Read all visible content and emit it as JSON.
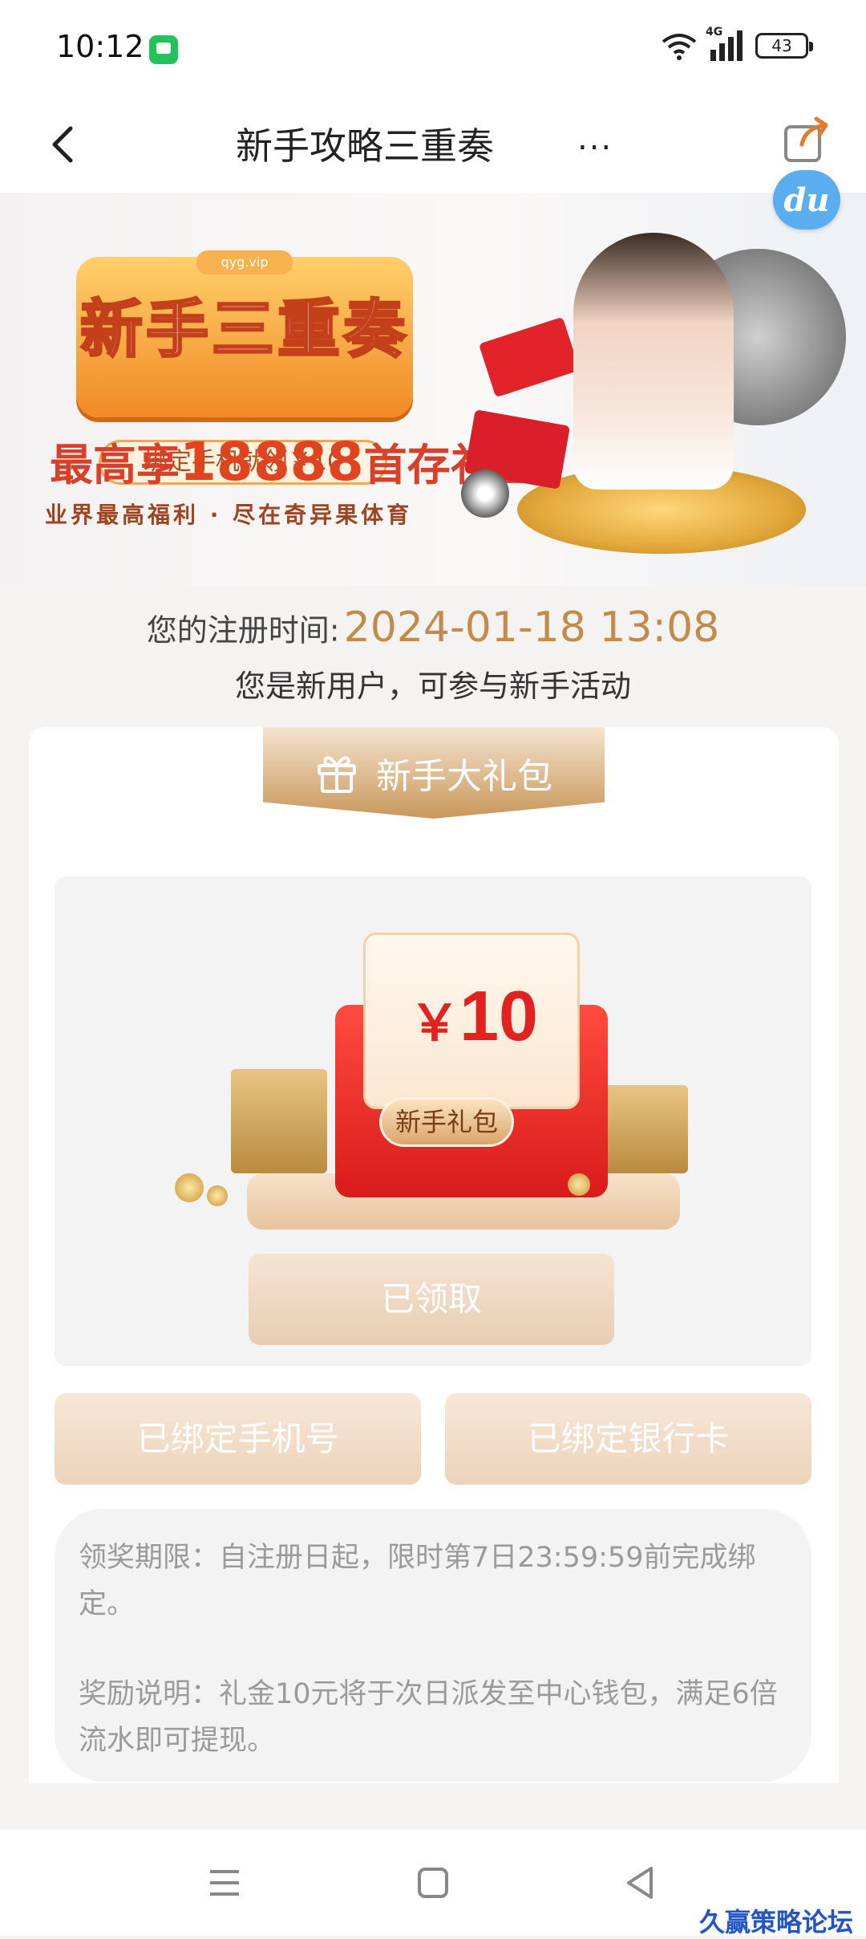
{
  "status_bar": {
    "time": "10:12",
    "network": "4G",
    "battery": "43",
    "icons": [
      "message-app-icon",
      "wifi-icon",
      "signal-icon",
      "battery-icon"
    ]
  },
  "header": {
    "title": "新手攻略三重奏",
    "more": "...",
    "icons": [
      "back-arrow-icon",
      "share-icon"
    ]
  },
  "floating_badge": {
    "label": "du"
  },
  "banner": {
    "site": "qyg.vip",
    "headline": "新手三重奏",
    "bind_phone": "绑定手机就领￥10",
    "max_prefix": "最高享",
    "max_amount": "18888",
    "max_suffix": "首存礼金",
    "slogan": "业界最高福利 · 尽在奇异果体育"
  },
  "registration": {
    "label": "您的注册时间:",
    "time": "2024-01-18 13:08",
    "note": "您是新用户，可参与新手活动"
  },
  "gift_section": {
    "ribbon_label": "新手大礼包",
    "ribbon_icon": "gift-icon",
    "voucher_currency": "￥",
    "voucher_amount": "10",
    "voucher_tag": "新手礼包",
    "claimed_label": "已领取"
  },
  "bind_buttons": {
    "phone": "已绑定手机号",
    "bank_card": "已绑定银行卡"
  },
  "rules": {
    "deadline": "领奖期限：自注册日起，限时第7日23:59:59前完成绑定。",
    "reward": "奖励说明：礼金10元将于次日派发至中心钱包，满足6倍流水即可提现。"
  },
  "nav_bar": {
    "icons": [
      "menu-icon",
      "home-icon",
      "back-icon"
    ]
  },
  "watermark": "久赢策略论坛",
  "colors": {
    "accent_gold": "#c28b4a",
    "voucher_red": "#e2221f",
    "page_bg": "#f4f3f2"
  }
}
